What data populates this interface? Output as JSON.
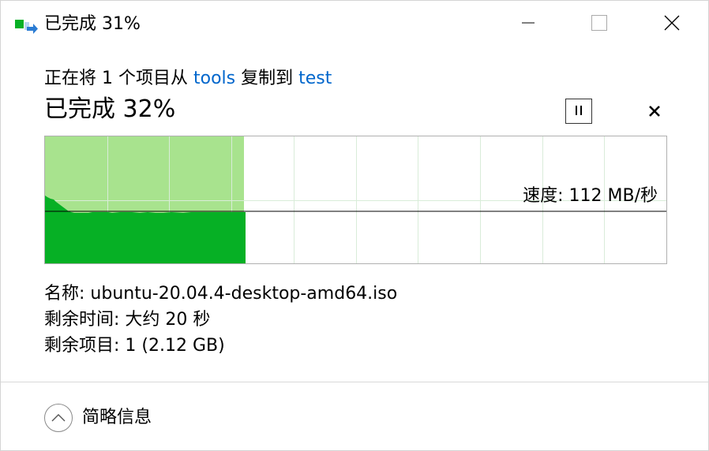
{
  "window": {
    "title": "已完成 31%",
    "icon": "copy-file-icon",
    "controls": {
      "minimize_icon": "minimize-icon",
      "maximize_icon": "maximize-icon",
      "close_icon": "close-icon"
    }
  },
  "copy": {
    "desc_prefix": "正在将 1 个项目从 ",
    "source": "tools",
    "desc_middle": " 复制到 ",
    "destination": "test",
    "progress_heading": "已完成 32%",
    "progress_value": 0.32
  },
  "actions": {
    "pause_icon": "pause-icon",
    "cancel_icon": "cancel-icon"
  },
  "graph": {
    "speed_label": "速度: 112 MB/秒",
    "fill_color": "#a8e38e",
    "speed_fill_color": "#06b025",
    "grid_color": "#d9ecd9"
  },
  "details": {
    "name_label": "名称: ",
    "name_value": "ubuntu-20.04.4-desktop-amd64.iso",
    "time_label": "剩余时间: ",
    "time_value": "大约 20 秒",
    "items_label": "剩余项目: ",
    "items_value": "1 (2.12 GB)"
  },
  "footer": {
    "toggle_label": "简略信息",
    "toggle_icon": "chevron-up-icon"
  }
}
